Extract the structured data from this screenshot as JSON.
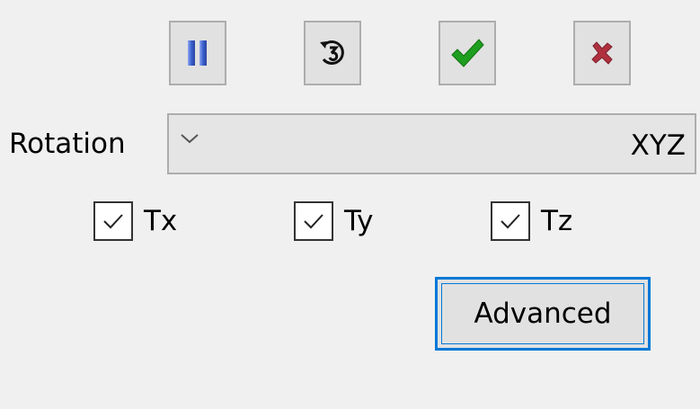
{
  "toolbar": {
    "pause_icon": "pause-icon",
    "reset_icon": "reset-icon",
    "apply_icon": "check-icon",
    "cancel_icon": "close-icon",
    "pause_color": "#3a5fcd",
    "apply_color": "#1e9e1e",
    "cancel_color": "#b0303f"
  },
  "rotation": {
    "label": "Rotation",
    "value": "XYZ"
  },
  "translations": [
    {
      "label": "Tx",
      "checked": true
    },
    {
      "label": "Ty",
      "checked": true
    },
    {
      "label": "Tz",
      "checked": true
    }
  ],
  "advanced": {
    "label": "Advanced"
  },
  "colors": {
    "focus_border": "#0078d7",
    "button_bg": "#e1e1e1",
    "panel_bg": "#f0f0f0"
  }
}
